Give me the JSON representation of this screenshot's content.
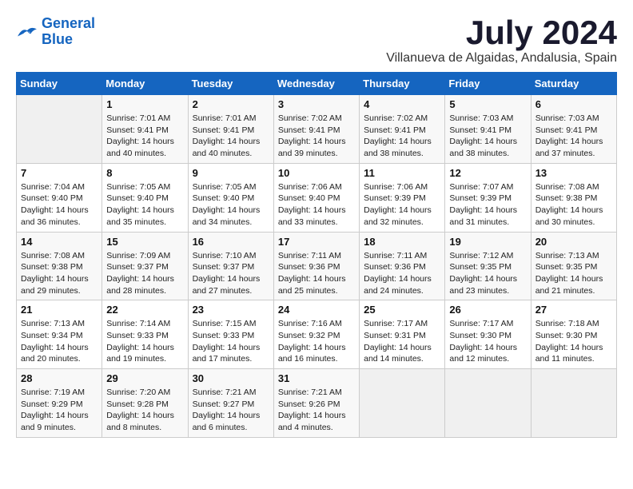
{
  "logo": {
    "line1": "General",
    "line2": "Blue"
  },
  "title": "July 2024",
  "location": "Villanueva de Algaidas, Andalusia, Spain",
  "weekdays": [
    "Sunday",
    "Monday",
    "Tuesday",
    "Wednesday",
    "Thursday",
    "Friday",
    "Saturday"
  ],
  "weeks": [
    [
      {
        "day": "",
        "info": ""
      },
      {
        "day": "1",
        "info": "Sunrise: 7:01 AM\nSunset: 9:41 PM\nDaylight: 14 hours\nand 40 minutes."
      },
      {
        "day": "2",
        "info": "Sunrise: 7:01 AM\nSunset: 9:41 PM\nDaylight: 14 hours\nand 40 minutes."
      },
      {
        "day": "3",
        "info": "Sunrise: 7:02 AM\nSunset: 9:41 PM\nDaylight: 14 hours\nand 39 minutes."
      },
      {
        "day": "4",
        "info": "Sunrise: 7:02 AM\nSunset: 9:41 PM\nDaylight: 14 hours\nand 38 minutes."
      },
      {
        "day": "5",
        "info": "Sunrise: 7:03 AM\nSunset: 9:41 PM\nDaylight: 14 hours\nand 38 minutes."
      },
      {
        "day": "6",
        "info": "Sunrise: 7:03 AM\nSunset: 9:41 PM\nDaylight: 14 hours\nand 37 minutes."
      }
    ],
    [
      {
        "day": "7",
        "info": "Sunrise: 7:04 AM\nSunset: 9:40 PM\nDaylight: 14 hours\nand 36 minutes."
      },
      {
        "day": "8",
        "info": "Sunrise: 7:05 AM\nSunset: 9:40 PM\nDaylight: 14 hours\nand 35 minutes."
      },
      {
        "day": "9",
        "info": "Sunrise: 7:05 AM\nSunset: 9:40 PM\nDaylight: 14 hours\nand 34 minutes."
      },
      {
        "day": "10",
        "info": "Sunrise: 7:06 AM\nSunset: 9:40 PM\nDaylight: 14 hours\nand 33 minutes."
      },
      {
        "day": "11",
        "info": "Sunrise: 7:06 AM\nSunset: 9:39 PM\nDaylight: 14 hours\nand 32 minutes."
      },
      {
        "day": "12",
        "info": "Sunrise: 7:07 AM\nSunset: 9:39 PM\nDaylight: 14 hours\nand 31 minutes."
      },
      {
        "day": "13",
        "info": "Sunrise: 7:08 AM\nSunset: 9:38 PM\nDaylight: 14 hours\nand 30 minutes."
      }
    ],
    [
      {
        "day": "14",
        "info": "Sunrise: 7:08 AM\nSunset: 9:38 PM\nDaylight: 14 hours\nand 29 minutes."
      },
      {
        "day": "15",
        "info": "Sunrise: 7:09 AM\nSunset: 9:37 PM\nDaylight: 14 hours\nand 28 minutes."
      },
      {
        "day": "16",
        "info": "Sunrise: 7:10 AM\nSunset: 9:37 PM\nDaylight: 14 hours\nand 27 minutes."
      },
      {
        "day": "17",
        "info": "Sunrise: 7:11 AM\nSunset: 9:36 PM\nDaylight: 14 hours\nand 25 minutes."
      },
      {
        "day": "18",
        "info": "Sunrise: 7:11 AM\nSunset: 9:36 PM\nDaylight: 14 hours\nand 24 minutes."
      },
      {
        "day": "19",
        "info": "Sunrise: 7:12 AM\nSunset: 9:35 PM\nDaylight: 14 hours\nand 23 minutes."
      },
      {
        "day": "20",
        "info": "Sunrise: 7:13 AM\nSunset: 9:35 PM\nDaylight: 14 hours\nand 21 minutes."
      }
    ],
    [
      {
        "day": "21",
        "info": "Sunrise: 7:13 AM\nSunset: 9:34 PM\nDaylight: 14 hours\nand 20 minutes."
      },
      {
        "day": "22",
        "info": "Sunrise: 7:14 AM\nSunset: 9:33 PM\nDaylight: 14 hours\nand 19 minutes."
      },
      {
        "day": "23",
        "info": "Sunrise: 7:15 AM\nSunset: 9:33 PM\nDaylight: 14 hours\nand 17 minutes."
      },
      {
        "day": "24",
        "info": "Sunrise: 7:16 AM\nSunset: 9:32 PM\nDaylight: 14 hours\nand 16 minutes."
      },
      {
        "day": "25",
        "info": "Sunrise: 7:17 AM\nSunset: 9:31 PM\nDaylight: 14 hours\nand 14 minutes."
      },
      {
        "day": "26",
        "info": "Sunrise: 7:17 AM\nSunset: 9:30 PM\nDaylight: 14 hours\nand 12 minutes."
      },
      {
        "day": "27",
        "info": "Sunrise: 7:18 AM\nSunset: 9:30 PM\nDaylight: 14 hours\nand 11 minutes."
      }
    ],
    [
      {
        "day": "28",
        "info": "Sunrise: 7:19 AM\nSunset: 9:29 PM\nDaylight: 14 hours\nand 9 minutes."
      },
      {
        "day": "29",
        "info": "Sunrise: 7:20 AM\nSunset: 9:28 PM\nDaylight: 14 hours\nand 8 minutes."
      },
      {
        "day": "30",
        "info": "Sunrise: 7:21 AM\nSunset: 9:27 PM\nDaylight: 14 hours\nand 6 minutes."
      },
      {
        "day": "31",
        "info": "Sunrise: 7:21 AM\nSunset: 9:26 PM\nDaylight: 14 hours\nand 4 minutes."
      },
      {
        "day": "",
        "info": ""
      },
      {
        "day": "",
        "info": ""
      },
      {
        "day": "",
        "info": ""
      }
    ]
  ]
}
